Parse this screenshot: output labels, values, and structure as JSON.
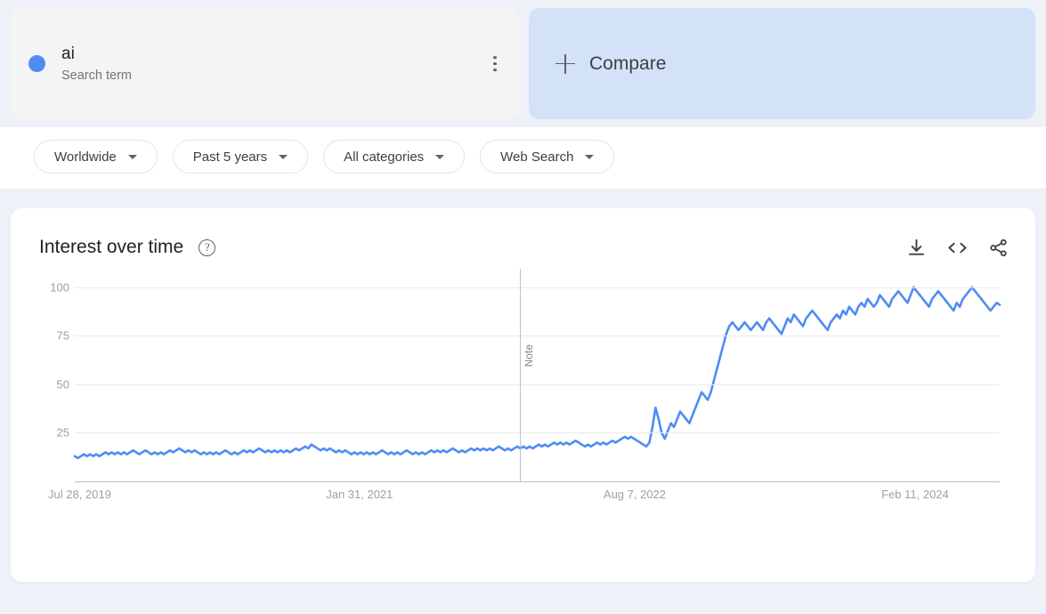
{
  "search_card": {
    "term": "ai",
    "subtitle": "Search term",
    "dot_color": "#4e8cf4",
    "menu_icon": "more-vertical-icon"
  },
  "compare_card": {
    "label": "Compare",
    "plus_icon": "plus-icon",
    "background": "#d3e2f7"
  },
  "filters": [
    {
      "label": "Worldwide",
      "icon": "chevron-down-icon"
    },
    {
      "label": "Past 5 years",
      "icon": "chevron-down-icon"
    },
    {
      "label": "All categories",
      "icon": "chevron-down-icon"
    },
    {
      "label": "Web Search",
      "icon": "chevron-down-icon"
    }
  ],
  "chart_card": {
    "title": "Interest over time",
    "help_icon": "help-circle-icon",
    "help_glyph": "?",
    "actions": [
      {
        "name": "download-icon",
        "tooltip": "Download"
      },
      {
        "name": "embed-code-icon",
        "tooltip": "Embed"
      },
      {
        "name": "share-icon",
        "tooltip": "Share"
      }
    ]
  },
  "chart_data": {
    "type": "line",
    "title": "Interest over time",
    "xlabel": "",
    "ylabel": "",
    "ylim": [
      0,
      105
    ],
    "yticks": [
      25,
      50,
      75,
      100
    ],
    "grid": true,
    "legend": false,
    "line_color": "#4e8cf4",
    "xtick_labels": [
      "Jul 28, 2019",
      "Jan 31, 2021",
      "Aug 7, 2022",
      "Feb 11, 2024"
    ],
    "xtick_positions": [
      0.0,
      0.3005,
      0.6005,
      0.901
    ],
    "annotations": [
      {
        "label": "Note",
        "x_fraction": 0.4815
      }
    ],
    "series": [
      {
        "name": "ai",
        "values": [
          13,
          12,
          13,
          14,
          13,
          14,
          13,
          14,
          13,
          14,
          15,
          14,
          15,
          14,
          15,
          14,
          15,
          14,
          15,
          16,
          15,
          14,
          15,
          16,
          15,
          14,
          15,
          14,
          15,
          14,
          15,
          16,
          15,
          16,
          17,
          16,
          15,
          16,
          15,
          16,
          15,
          14,
          15,
          14,
          15,
          14,
          15,
          14,
          15,
          16,
          15,
          14,
          15,
          14,
          15,
          16,
          15,
          16,
          15,
          16,
          17,
          16,
          15,
          16,
          15,
          16,
          15,
          16,
          15,
          16,
          15,
          16,
          17,
          16,
          17,
          18,
          17,
          19,
          18,
          17,
          16,
          17,
          16,
          17,
          16,
          15,
          16,
          15,
          16,
          15,
          14,
          15,
          14,
          15,
          14,
          15,
          14,
          15,
          14,
          15,
          16,
          15,
          14,
          15,
          14,
          15,
          14,
          15,
          16,
          15,
          14,
          15,
          14,
          15,
          14,
          15,
          16,
          15,
          16,
          15,
          16,
          15,
          16,
          17,
          16,
          15,
          16,
          15,
          16,
          17,
          16,
          17,
          16,
          17,
          16,
          17,
          16,
          17,
          18,
          17,
          16,
          17,
          16,
          17,
          18,
          17,
          18,
          17,
          18,
          17,
          18,
          19,
          18,
          19,
          18,
          19,
          20,
          19,
          20,
          19,
          20,
          19,
          20,
          21,
          20,
          19,
          18,
          19,
          18,
          19,
          20,
          19,
          20,
          19,
          20,
          21,
          20,
          21,
          22,
          23,
          22,
          23,
          22,
          21,
          20,
          19,
          18,
          20,
          28,
          38,
          32,
          25,
          22,
          26,
          30,
          28,
          32,
          36,
          34,
          32,
          30,
          34,
          38,
          42,
          46,
          44,
          42,
          46,
          52,
          58,
          64,
          70,
          76,
          80,
          82,
          80,
          78,
          80,
          82,
          80,
          78,
          80,
          82,
          80,
          78,
          82,
          84,
          82,
          80,
          78,
          76,
          80,
          84,
          82,
          86,
          84,
          82,
          80,
          84,
          86,
          88,
          86,
          84,
          82,
          80,
          78,
          82,
          84,
          86,
          84,
          88,
          86,
          90,
          88,
          86,
          90,
          92,
          90,
          94,
          92,
          90,
          92,
          96,
          94,
          92,
          90,
          94,
          96,
          98,
          96,
          94,
          92,
          96,
          100,
          98,
          96,
          94,
          92,
          90,
          94,
          96,
          98,
          96,
          94,
          92,
          90,
          88,
          92,
          90,
          94,
          96,
          98,
          100,
          98,
          96,
          94,
          92,
          90,
          88,
          90,
          92,
          91
        ]
      }
    ]
  }
}
